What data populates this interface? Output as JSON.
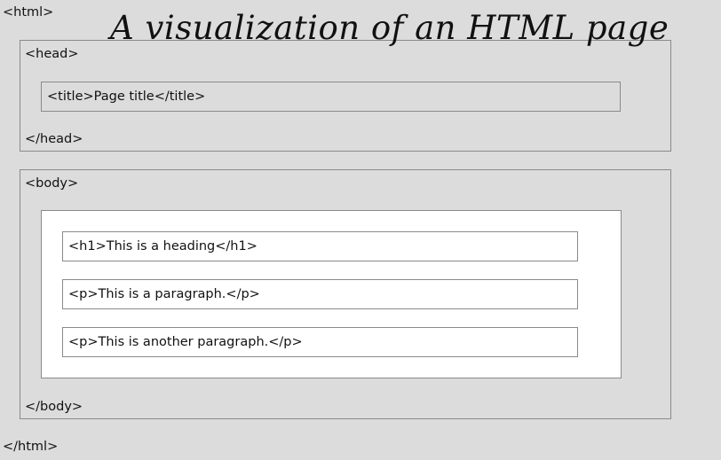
{
  "title": "A visualization of an HTML page",
  "html": {
    "open": "<html>",
    "close": "</html>"
  },
  "head": {
    "open": "<head>",
    "close": "</head>",
    "title_element": "<title>Page title</title>"
  },
  "body": {
    "open": "<body>",
    "close": "</body>",
    "elements": [
      "<h1>This is a heading</h1>",
      "<p>This is a paragraph.</p>",
      "<p>This is another paragraph.</p>"
    ]
  }
}
